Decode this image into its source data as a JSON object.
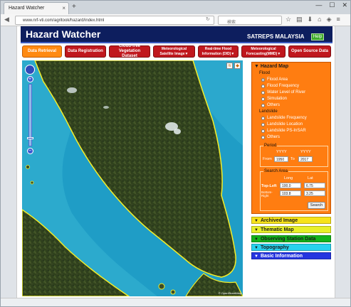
{
  "browser": {
    "tab_title": "Hazard Watcher",
    "tab_close": "×",
    "new_tab": "+",
    "url": "www.nrf-vti.com/agritook/hazard/index.html",
    "search_placeholder": "検索",
    "window_controls": [
      "—",
      "☐",
      "✕"
    ]
  },
  "header": {
    "title": "Hazard Watcher",
    "org": "SATREPS MALAYSIA",
    "help_label": "Help"
  },
  "menu": [
    {
      "label": "Data Retrieval",
      "active": true
    },
    {
      "label": "Data Registration",
      "active": false
    },
    {
      "label": "Cloud-free Vegetation Dataset",
      "active": false
    },
    {
      "label": "Meteorological Satellite Image▼",
      "active": false
    },
    {
      "label": "Real-time Flood Information (DID)▼",
      "active": false
    },
    {
      "label": "Meteorological Forecasting(MMD)▼",
      "active": false
    },
    {
      "label": "Open Source Data",
      "active": false
    }
  ],
  "map": {
    "attribution": "© OpenStreetMap"
  },
  "hazard_map": {
    "title": "▼ Hazard Map",
    "flood_label": "Flood",
    "flood_options": [
      "Flood Area",
      "Flood Frequency",
      "Water Level of River",
      "Simulation",
      "Others"
    ],
    "flood_selected": 0,
    "landslide_label": "Landslide",
    "landslide_options": [
      "Landslide Frequency",
      "Landslide Location",
      "Landslide PS-InSAR",
      "Others"
    ],
    "period": {
      "legend": "Period",
      "from_label": "From",
      "to_label": "To",
      "from_header": "YYYY",
      "to_header": "YYYY",
      "from_value": "1950",
      "to_value": "2017"
    },
    "search_area": {
      "legend": "Search Area",
      "long_label": "Long",
      "lat_label": "Lat",
      "top_left_label": "Top-Left",
      "bottom_right_label": "Bottom-Right",
      "top_left_long": "100.0",
      "top_left_lat": "6.75",
      "bottom_right_long": "103.8",
      "bottom_right_lat": "3.25",
      "search_label": "Search"
    }
  },
  "sections": [
    {
      "label": "Archived Image",
      "color": "#f7e31a"
    },
    {
      "label": "Thematic Map",
      "color": "#e8f02a"
    },
    {
      "label": "Observing Station Data",
      "color": "#13b31c"
    },
    {
      "label": "Topography",
      "color": "#28d2ee"
    },
    {
      "label": "Basic Information",
      "color": "#2535e0"
    }
  ],
  "colors": {
    "header_bg": "#0d1e5e",
    "menu_red": "#c0181e",
    "menu_active": "#ff8a12",
    "panel_orange": "#ff7d11"
  }
}
